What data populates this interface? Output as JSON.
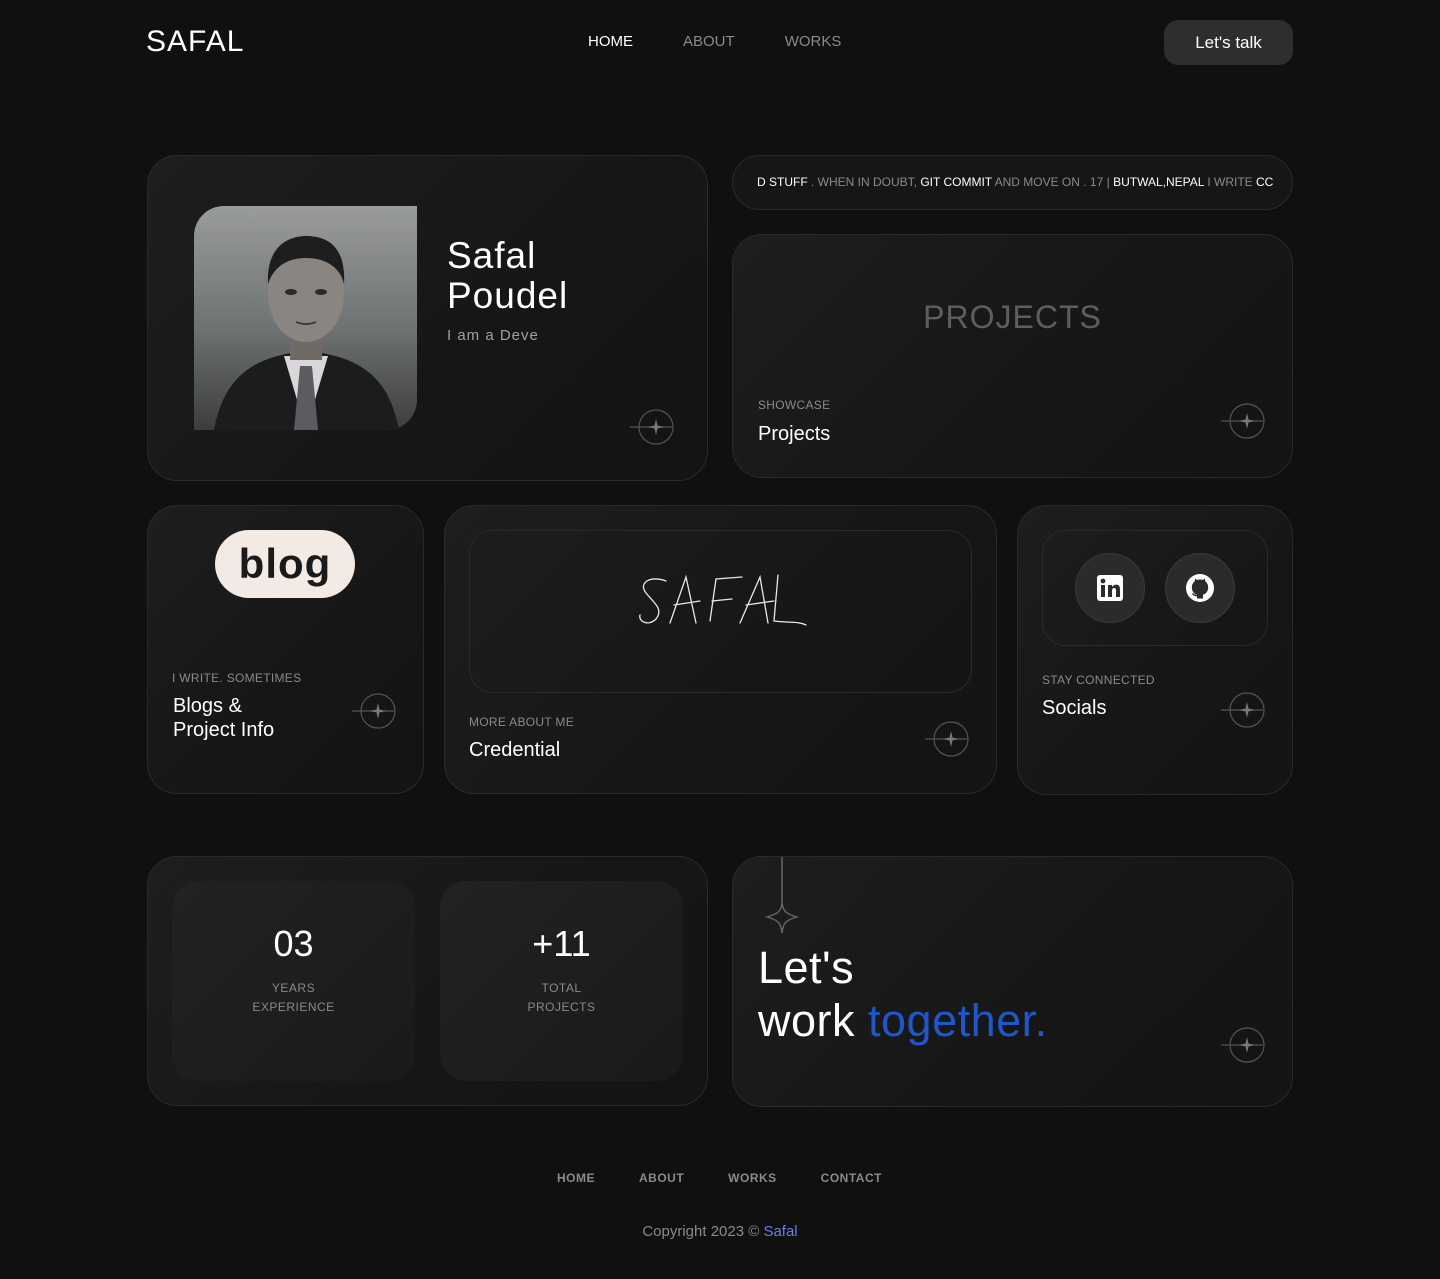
{
  "header": {
    "logo": "SAFAL",
    "nav": [
      "HOME",
      "ABOUT",
      "WORKS"
    ],
    "cta": "Let's talk"
  },
  "profile": {
    "first_name": "Safal",
    "last_name": "Poudel",
    "role": "I am a Deve"
  },
  "marquee": {
    "parts": [
      {
        "text": "D",
        "strong": true
      },
      {
        "text": " STUFF",
        "strong": true
      },
      {
        "text": " . WHEN IN DOUBT, ",
        "strong": false
      },
      {
        "text": "GIT COMMIT",
        "strong": true
      },
      {
        "text": " AND MOVE ON . 17 | ",
        "strong": false
      },
      {
        "text": "BUTWAL,NEPAL",
        "strong": true
      },
      {
        "text": " I WRITE ",
        "strong": false
      },
      {
        "text": "CC",
        "strong": true
      }
    ]
  },
  "projects_card": {
    "big_label": "PROJECTS",
    "kicker": "SHOWCASE",
    "title": "Projects"
  },
  "blog_card": {
    "badge": "blog",
    "kicker": "I WRITE. SOMETIMES",
    "title_line1": "Blogs &",
    "title_line2": "Project Info"
  },
  "credential_card": {
    "signature": "SAFAL",
    "kicker": "MORE ABOUT ME",
    "title": "Credential"
  },
  "socials_card": {
    "icons": [
      "linkedin-icon",
      "github-icon"
    ],
    "kicker": "STAY CONNECTED",
    "title": "Socials"
  },
  "stats": [
    {
      "value": "03",
      "line1": "YEARS",
      "line2": "EXPERIENCE"
    },
    {
      "value": "+11",
      "line1": "TOTAL",
      "line2": "PROJECTS"
    }
  ],
  "together_card": {
    "line1": "Let's",
    "line2a": "work ",
    "line2b": "together.",
    "accent": "#1f56c9"
  },
  "footer": {
    "nav": [
      "HOME",
      "ABOUT",
      "WORKS",
      "CONTACT"
    ],
    "copyright_prefix": "Copyright 2023 © ",
    "copyright_link": "Safal"
  }
}
